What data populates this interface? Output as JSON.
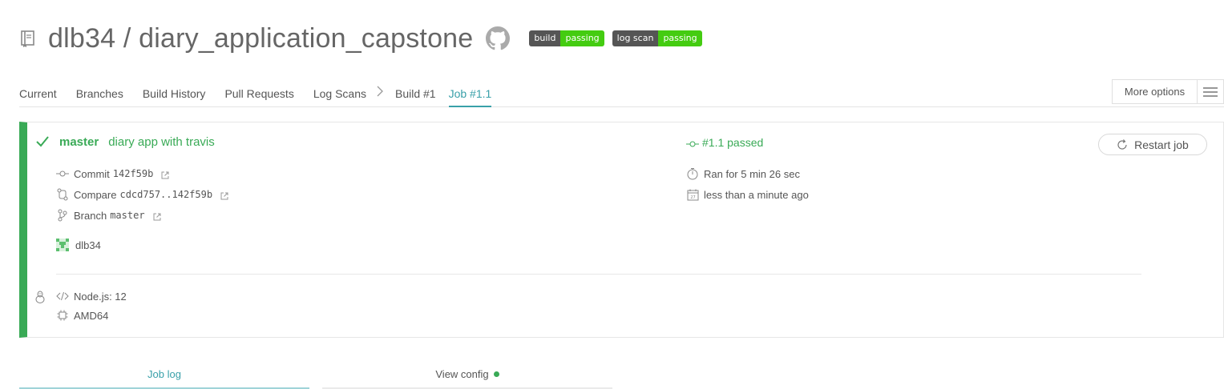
{
  "repo": {
    "title": "dlb34 / diary_application_capstone",
    "badges": [
      {
        "label": "build",
        "status": "passing"
      },
      {
        "label": "log scan",
        "status": "passing"
      }
    ]
  },
  "tabs": {
    "current": "Current",
    "branches": "Branches",
    "build_history": "Build History",
    "pull_requests": "Pull Requests",
    "log_scans": "Log Scans",
    "separator": ">",
    "build": "Build #1",
    "job": "Job #1.1"
  },
  "more_options": {
    "label": "More options"
  },
  "job": {
    "branch": "master",
    "commit_message": "diary app with travis",
    "status": "#1.1 passed",
    "commit_label": "Commit",
    "commit_sha": "142f59b",
    "compare_label": "Compare",
    "compare_range": "cdcd757..142f59b",
    "branch_label": "Branch",
    "branch_value": "master",
    "author": "dlb34",
    "duration": "Ran for 5 min 26 sec",
    "finished": "less than a minute ago",
    "restart_label": "Restart job",
    "language": "Node.js: 12",
    "arch": "AMD64"
  },
  "bottom_tabs": {
    "job_log": "Job log",
    "view_config": "View config"
  },
  "colors": {
    "passed": "#39aa56",
    "accent": "#39a0a9",
    "badge_left": "#555555",
    "badge_right": "#44cc11"
  }
}
